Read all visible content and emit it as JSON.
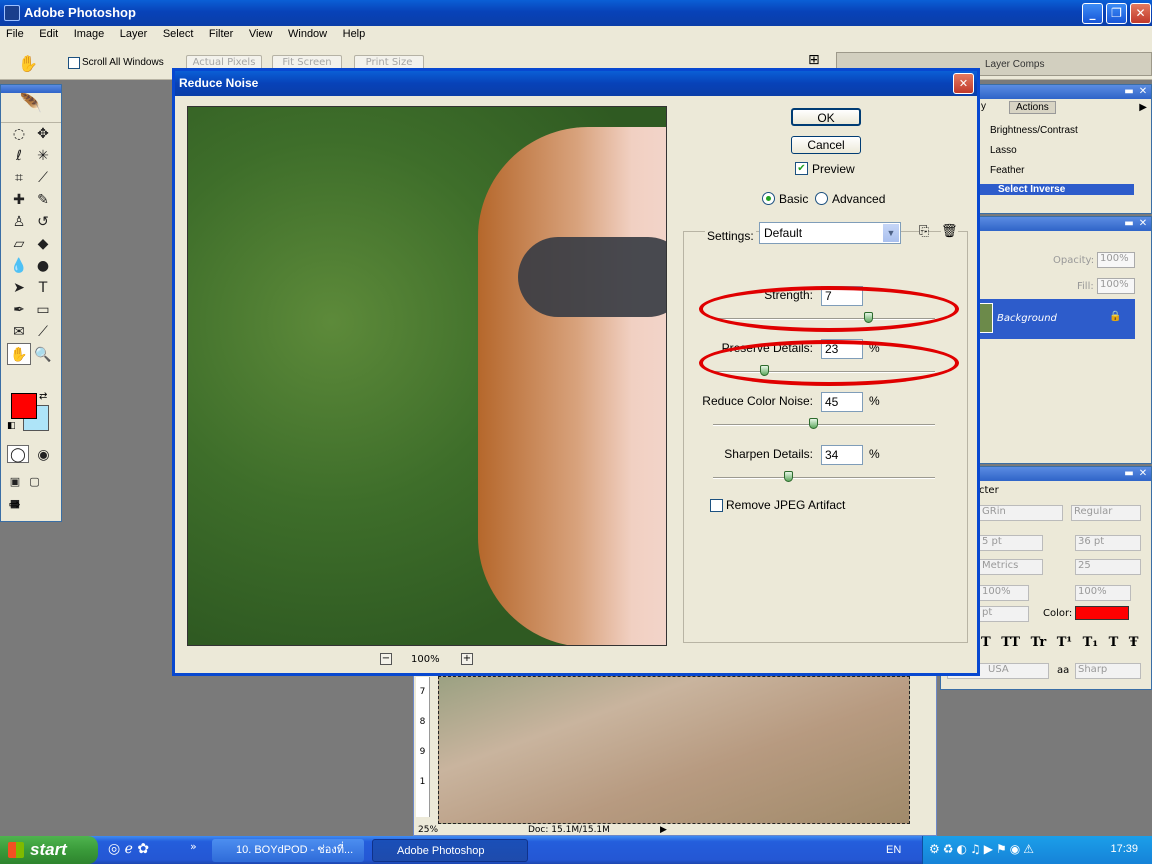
{
  "app": {
    "title": "Adobe Photoshop"
  },
  "menu": [
    "File",
    "Edit",
    "Image",
    "Layer",
    "Select",
    "Filter",
    "View",
    "Window",
    "Help"
  ],
  "options": {
    "scroll_all_label": "Scroll All Windows",
    "actual_pixels": "Actual Pixels",
    "fit_screen": "Fit Screen",
    "print_size": "Print Size"
  },
  "palette_well": {
    "layer_comps": "Layer Comps"
  },
  "history": {
    "tab": "Actions",
    "items": [
      "Brightness/Contrast",
      "Lasso",
      "Feather",
      "Select Inverse"
    ]
  },
  "layers": {
    "opacity_label": "Opacity:",
    "opacity_value": "100%",
    "fill_label": "Fill:",
    "fill_value": "100%",
    "layer_name": "Background"
  },
  "character": {
    "tab": "cter",
    "font_family": "GRin",
    "font_style": "Regular",
    "size": "5 pt",
    "leading": "36 pt",
    "kerning": "Metrics",
    "tracking": "25",
    "vscale": "100%",
    "hscale": "100%",
    "baseline": "pt",
    "color_label": "Color:",
    "color": "#ff0000",
    "language": "USA",
    "aa_label": "aa",
    "antialias": "Sharp",
    "style_buttons": [
      "T",
      "TT",
      "Tr",
      "T¹",
      "T₁",
      "T",
      "Ŧ"
    ]
  },
  "doc": {
    "zoom": "25%",
    "docsize": "Doc: 15.1M/15.1M"
  },
  "dialog": {
    "title": "Reduce Noise",
    "ok": "OK",
    "cancel": "Cancel",
    "preview_label": "Preview",
    "preview_checked": true,
    "mode_basic": "Basic",
    "mode_advanced": "Advanced",
    "mode_selected": "Basic",
    "zoom": "100%",
    "settings_label": "Settings:",
    "settings_value": "Default",
    "sliders": [
      {
        "label": "Strength:",
        "value": "7",
        "unit": "",
        "level": 0.7
      },
      {
        "label": "Preserve Details:",
        "value": "23",
        "unit": "%",
        "level": 0.23
      },
      {
        "label": "Reduce Color Noise:",
        "value": "45",
        "unit": "%",
        "level": 0.45
      },
      {
        "label": "Sharpen Details:",
        "value": "34",
        "unit": "%",
        "level": 0.34
      }
    ],
    "remove_jpeg_label": "Remove JPEG Artifact",
    "remove_jpeg_checked": false
  },
  "taskbar": {
    "start": "start",
    "tasks": [
      "10. BOYdPOD - ช่องที่...",
      "Adobe Photoshop"
    ],
    "lang": "EN",
    "time": "17:39"
  }
}
